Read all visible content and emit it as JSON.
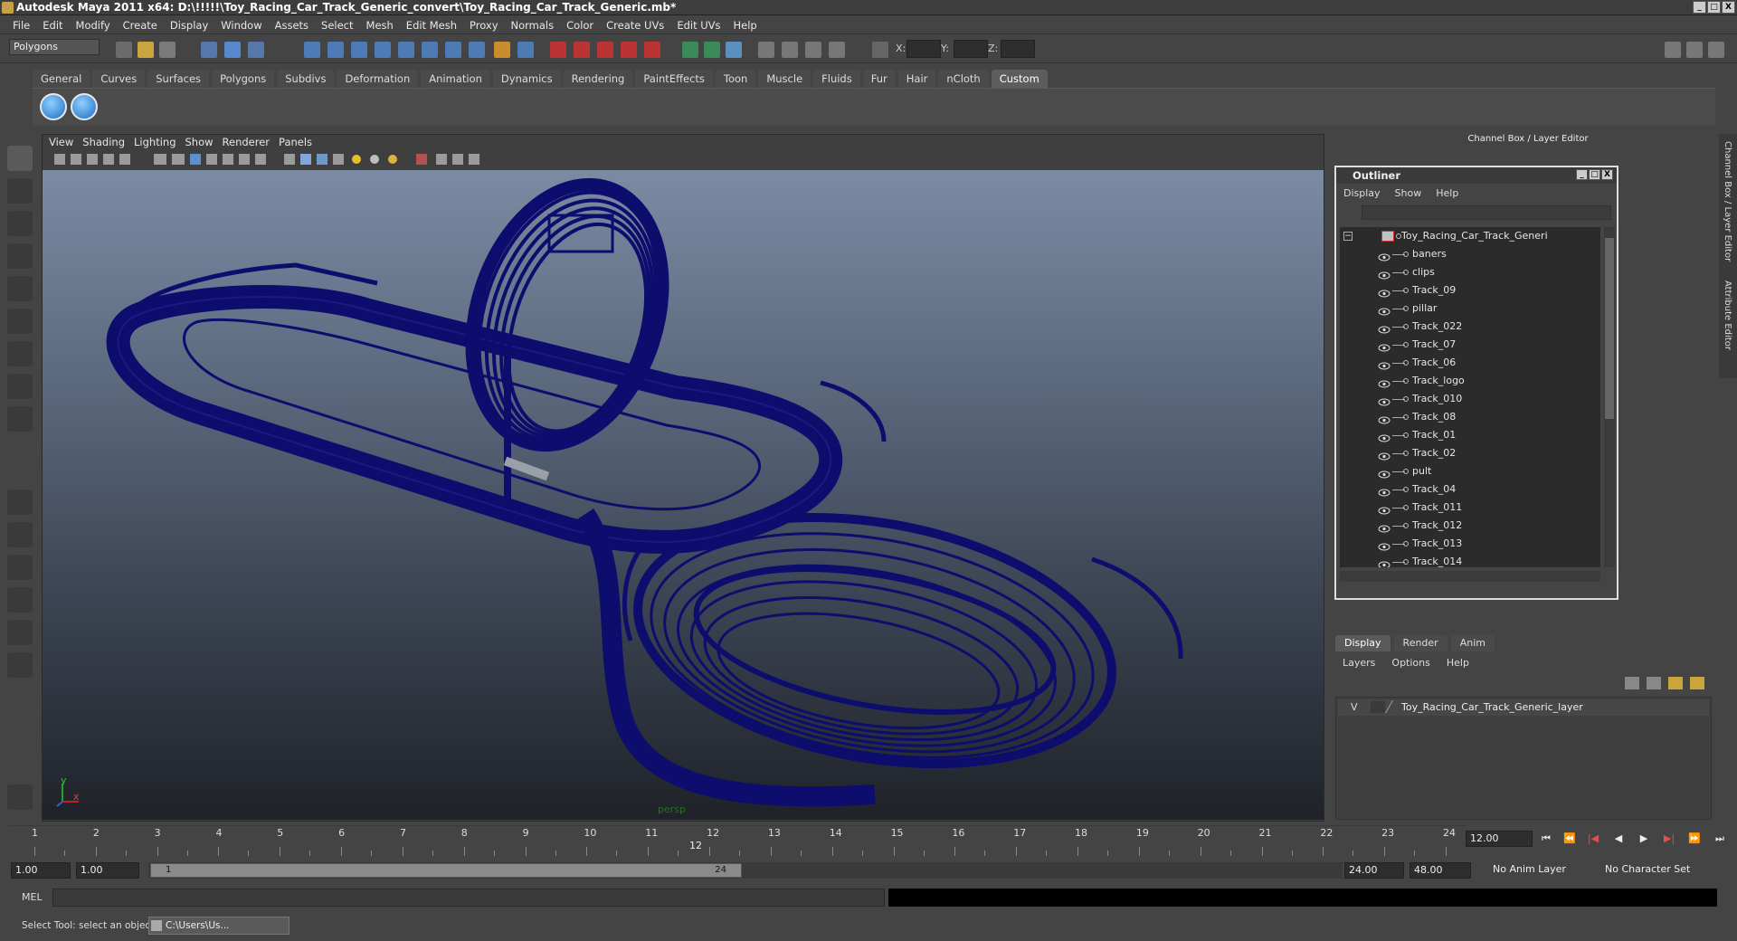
{
  "window": {
    "title": "Autodesk Maya 2011 x64: D:\\!!!!!\\Toy_Racing_Car_Track_Generic_convert\\Toy_Racing_Car_Track_Generic.mb*",
    "min": "_",
    "max": "□",
    "close": "X"
  },
  "menubar": [
    "File",
    "Edit",
    "Modify",
    "Create",
    "Display",
    "Window",
    "Assets",
    "Select",
    "Mesh",
    "Edit Mesh",
    "Proxy",
    "Normals",
    "Color",
    "Create UVs",
    "Edit UVs",
    "Help"
  ],
  "status": {
    "mode": "Polygons",
    "x_label": "X:",
    "y_label": "Y:",
    "z_label": "Z:"
  },
  "shelf": {
    "tabs": [
      "General",
      "Curves",
      "Surfaces",
      "Polygons",
      "Subdivs",
      "Deformation",
      "Animation",
      "Dynamics",
      "Rendering",
      "PaintEffects",
      "Toon",
      "Muscle",
      "Fluids",
      "Fur",
      "Hair",
      "nCloth",
      "Custom"
    ],
    "active": "Custom"
  },
  "viewport": {
    "menu": [
      "View",
      "Shading",
      "Lighting",
      "Show",
      "Renderer",
      "Panels"
    ],
    "camera": "persp",
    "axis_y": "y",
    "axis_x": "x",
    "wire_color": "#0d0d6e"
  },
  "channel_box": {
    "title": "Channel Box / Layer Editor"
  },
  "outliner": {
    "title": "Outliner",
    "menu": [
      "Display",
      "Show",
      "Help"
    ],
    "root": "Toy_Racing_Car_Track_Generi",
    "items": [
      "baners",
      "clips",
      "Track_09",
      "pillar",
      "Track_022",
      "Track_07",
      "Track_06",
      "Track_logo",
      "Track_010",
      "Track_08",
      "Track_01",
      "Track_02",
      "pult",
      "Track_04",
      "Track_011",
      "Track_012",
      "Track_013",
      "Track_014"
    ],
    "btn_min": "_",
    "btn_max": "□",
    "btn_close": "X"
  },
  "layer_editor": {
    "tabs": [
      "Display",
      "Render",
      "Anim"
    ],
    "active": "Display",
    "menu": [
      "Layers",
      "Options",
      "Help"
    ],
    "layer_visible": "V",
    "layer_name": "Toy_Racing_Car_Track_Generic_layer"
  },
  "side_tabs": {
    "channel": "Channel Box / Layer Editor",
    "attribute": "Attribute Editor"
  },
  "timeline": {
    "ticks": [
      "1",
      "2",
      "3",
      "4",
      "5",
      "6",
      "7",
      "8",
      "9",
      "10",
      "11",
      "12",
      "13",
      "14",
      "15",
      "16",
      "17",
      "18",
      "19",
      "20",
      "21",
      "22",
      "23",
      "24"
    ],
    "current_frame_label": "12",
    "current_time": "12.00"
  },
  "range": {
    "start": "1.00",
    "playback_start": "1.00",
    "handle_start": "1",
    "handle_end": "24",
    "playback_end": "24.00",
    "end": "48.00",
    "anim_layer": "No Anim Layer",
    "char_set": "No Character Set"
  },
  "command": {
    "mel_label": "MEL"
  },
  "help": {
    "text": "Select Tool: select an object",
    "task": "C:\\Users\\Us..."
  }
}
